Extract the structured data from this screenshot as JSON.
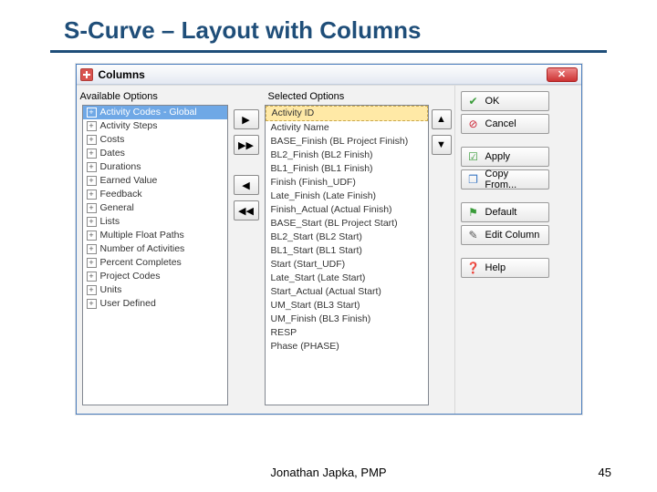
{
  "slide": {
    "title": "S-Curve – Layout with Columns",
    "footer_name": "Jonathan Japka, PMP",
    "page_number": "45"
  },
  "dialog": {
    "title": "Columns",
    "close_glyph": "✕",
    "available_label": "Available Options",
    "selected_label": "Selected Options",
    "available": [
      "Activity Codes - Global",
      "Activity Steps",
      "Costs",
      "Dates",
      "Durations",
      "Earned Value",
      "Feedback",
      "General",
      "Lists",
      "Multiple Float Paths",
      "Number of Activities",
      "Percent Completes",
      "Project Codes",
      "Units",
      "User Defined"
    ],
    "selected": [
      "Activity ID",
      "Activity Name",
      "BASE_Finish  (BL Project Finish)",
      "BL2_Finish  (BL2 Finish)",
      "BL1_Finish  (BL1 Finish)",
      "Finish  (Finish_UDF)",
      "Late_Finish  (Late Finish)",
      "Finish_Actual  (Actual Finish)",
      "BASE_Start  (BL Project Start)",
      "BL2_Start  (BL2 Start)",
      "BL1_Start  (BL1 Start)",
      "Start  (Start_UDF)",
      "Late_Start  (Late Start)",
      "Start_Actual  (Actual Start)",
      "UM_Start  (BL3 Start)",
      "UM_Finish  (BL3 Finish)",
      "RESP",
      "Phase  (PHASE)"
    ],
    "movers": {
      "add": "▶",
      "add_all": "▶▶",
      "remove": "◀",
      "remove_all": "◀◀"
    },
    "reorder": {
      "up": "▲",
      "down": "▼"
    },
    "buttons": {
      "ok": {
        "label": "OK",
        "glyph": "✔"
      },
      "cancel": {
        "label": "Cancel",
        "glyph": "⊘"
      },
      "apply": {
        "label": "Apply",
        "glyph": "�neuen"
      },
      "copy_from": {
        "label": "Copy From...",
        "glyph": "❐"
      },
      "default": {
        "label": "Default",
        "glyph": "⚑"
      },
      "edit_col": {
        "label": "Edit Column",
        "glyph": "✎"
      },
      "help": {
        "label": "Help",
        "glyph": "❓"
      }
    }
  }
}
